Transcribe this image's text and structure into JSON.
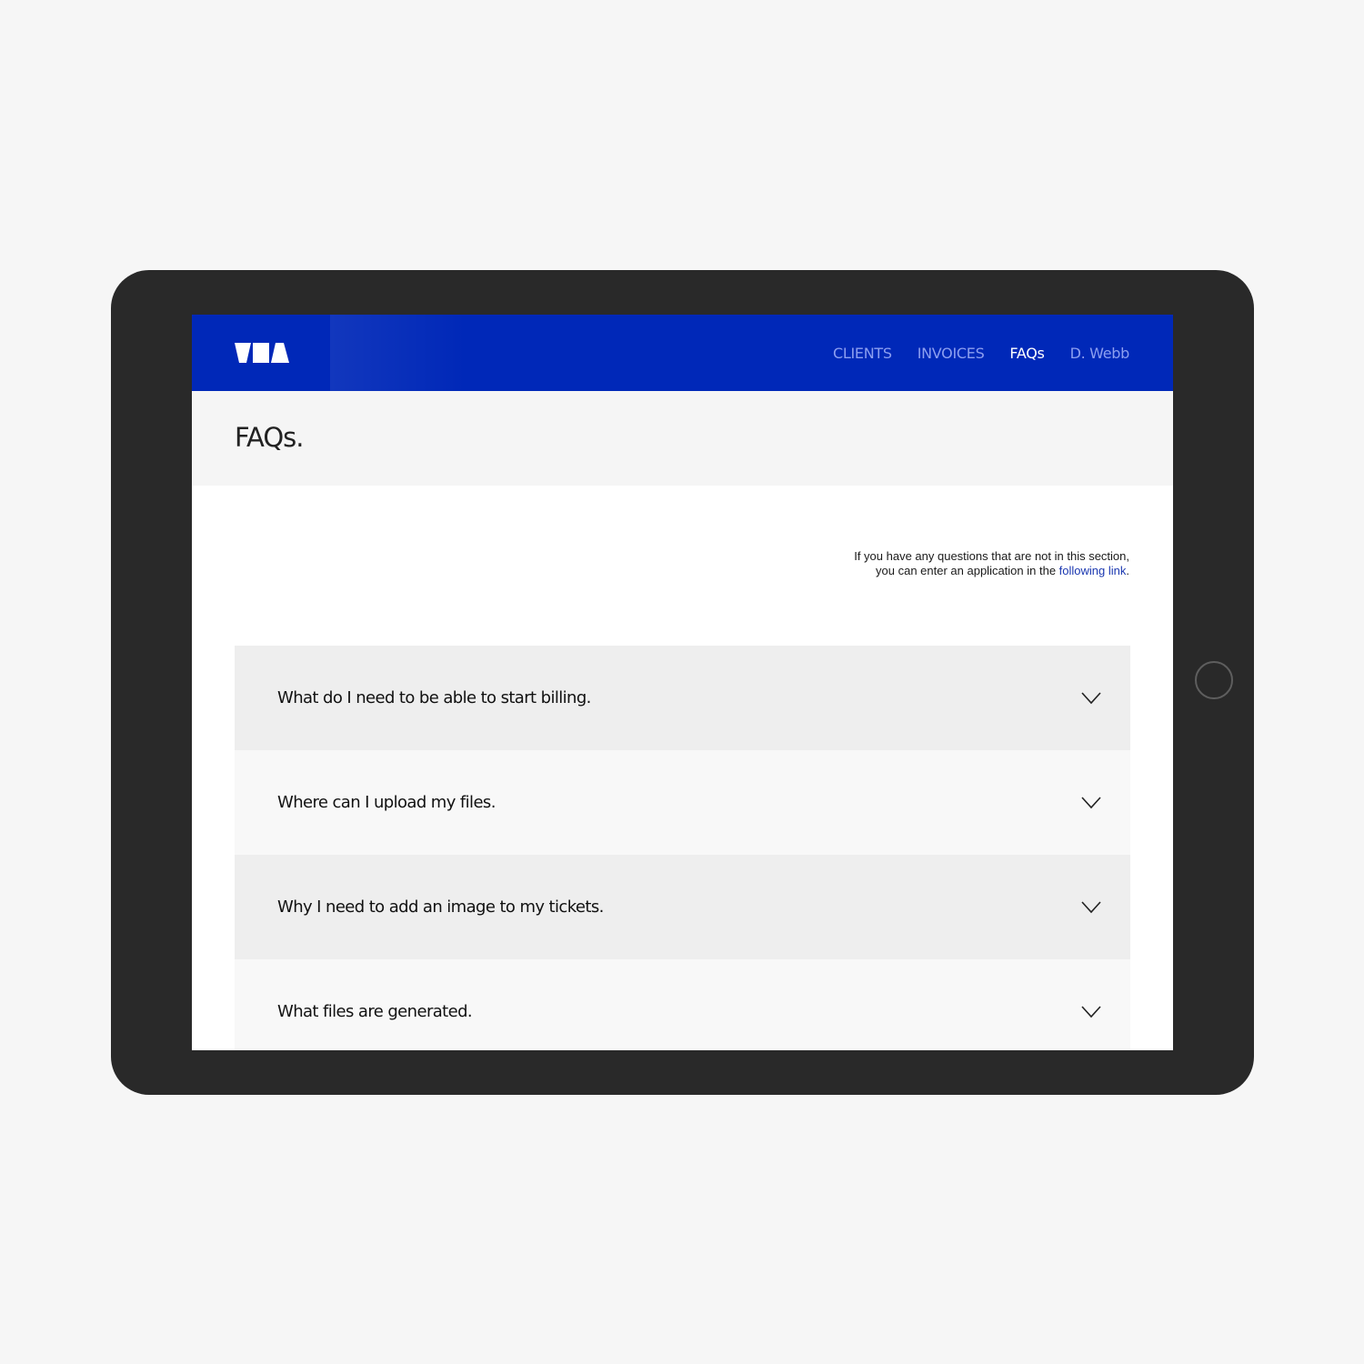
{
  "app": {
    "logo_text": "VMA",
    "brand_color": "#0028b8"
  },
  "nav": {
    "items": [
      {
        "label": "CLIENTS",
        "active": false
      },
      {
        "label": "INVOICES",
        "active": false
      },
      {
        "label": "FAQs",
        "active": true
      },
      {
        "label": "D. Webb",
        "active": false
      }
    ]
  },
  "page": {
    "title": "FAQs."
  },
  "note": {
    "line1": "If you have any questions that are not in this section,",
    "line2_prefix": "you can enter an application in the ",
    "link_text": "following link",
    "line2_suffix": "."
  },
  "faqs": [
    {
      "question": "What do I need to be able to start billing.",
      "icon": "chevron-down-icon"
    },
    {
      "question": "Where can I upload my files.",
      "icon": "chevron-down-icon"
    },
    {
      "question": "Why I need to add an image to my tickets.",
      "icon": "chevron-down-icon"
    },
    {
      "question": "What files are generated.",
      "icon": "chevron-down-icon"
    }
  ]
}
